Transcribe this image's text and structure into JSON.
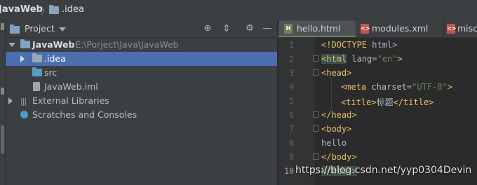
{
  "breadcrumb": {
    "project": "JavaWeb",
    "folder": ".idea"
  },
  "project_panel": {
    "title": "Project",
    "tree": [
      {
        "label": "JavaWeb",
        "path": "E:\\Porject\\Java\\JavaWeb"
      },
      {
        "label": ".idea"
      },
      {
        "label": "src"
      },
      {
        "label": "JavaWeb.iml"
      },
      {
        "label": "External Libraries"
      },
      {
        "label": "Scratches and Consoles"
      }
    ]
  },
  "editor": {
    "tabs": [
      {
        "label": "hello.html",
        "icon": "html-file-icon",
        "icon_text": "H"
      },
      {
        "label": "modules.xml",
        "icon": "xml-file-icon",
        "icon_text": "<>"
      },
      {
        "label": "misc",
        "icon": "xml-file-icon",
        "icon_text": "<>"
      }
    ],
    "line_numbers": [
      "1",
      "2",
      "3",
      "4",
      "5",
      "6",
      "7",
      "8",
      "9",
      "10"
    ],
    "lines": {
      "l1_tag": "<!DOCTYPE",
      "l1_rest": " html>",
      "l2_open": "<html",
      "l2_attr": " lang=",
      "l2_val": "\"en\"",
      "l2_close": ">",
      "l3": "<head>",
      "l4_open": "<meta",
      "l4_attr": " charset=",
      "l4_val": "\"UTF-8\"",
      "l4_close": ">",
      "l5_open": "<title>",
      "l5_text": "标题",
      "l5_close": "</title>",
      "l6": "</head>",
      "l7": "<body>",
      "l8": "hello",
      "l9": "</body>",
      "l10": "</html>"
    }
  },
  "watermark": "https://blog.csdn.net/yyp0304Devin",
  "colors": {
    "selection": "#4b6eaf",
    "tag": "#e8bf6a",
    "string": "#6a8759"
  }
}
